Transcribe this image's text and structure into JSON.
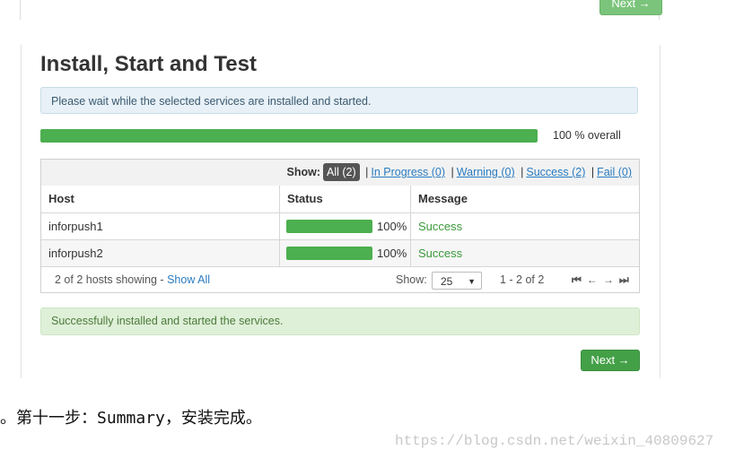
{
  "previous": {
    "next_label": "Next →"
  },
  "header": {
    "title": "Install, Start and Test"
  },
  "notice": {
    "text": "Please wait while the selected services are installed and started."
  },
  "overall": {
    "progress": 1.0,
    "label": "100 % overall"
  },
  "filter": {
    "show_label": "Show:",
    "all": "All (2)",
    "in_progress": "In Progress (0)",
    "warning": "Warning (0)",
    "success": "Success (2)",
    "fail": "Fail (0)",
    "separator": "|"
  },
  "table": {
    "columns": [
      "Host",
      "Status",
      "Message"
    ],
    "rows": [
      {
        "host": "inforpush1",
        "progress": 1.0,
        "percent": "100%",
        "message": "Success"
      },
      {
        "host": "inforpush2",
        "progress": 1.0,
        "percent": "100%",
        "message": "Success"
      }
    ]
  },
  "footer": {
    "hosts_showing": "2 of 2 hosts showing - ",
    "show_all": "Show All",
    "show_label": "Show:",
    "page_size": "25",
    "range": "1 - 2 of 2",
    "pager_icons": [
      "first-page-icon",
      "prev-page-icon",
      "next-page-icon",
      "last-page-icon"
    ]
  },
  "result": {
    "text": "Successfully installed and started the services."
  },
  "actions": {
    "next_label": "Next →"
  },
  "caption": {
    "marker": "。",
    "text": "第十一步：Summary，安装完成。"
  },
  "watermark": {
    "text": "https://blog.csdn.net/weixin_40809627"
  },
  "colors": {
    "success_green": "#43a047",
    "progress_green": "#4caf50",
    "link_blue": "#2a7bbf"
  }
}
